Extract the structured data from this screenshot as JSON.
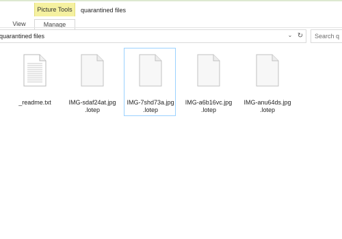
{
  "ribbon": {
    "context_group": "Picture Tools",
    "tabs": [
      "View",
      "Manage"
    ],
    "window_title": "quarantined files"
  },
  "address": {
    "path": "quarantined files",
    "search_placeholder": "Search q"
  },
  "files": [
    {
      "line1": "_readme.txt",
      "line2": "",
      "type": "text",
      "selected": false
    },
    {
      "line1": "IMG-sdaf24at.jpg",
      "line2": ".lotep",
      "type": "blank",
      "selected": false
    },
    {
      "line1": "IMG-7shd73a.jpg",
      "line2": ".lotep",
      "type": "blank",
      "selected": true
    },
    {
      "line1": "IMG-a6b16vc.jpg",
      "line2": ".lotep",
      "type": "blank",
      "selected": false
    },
    {
      "line1": "IMG-anu64ds.jpg",
      "line2": ".lotep",
      "type": "blank",
      "selected": false
    }
  ],
  "colors": {
    "context_highlight": "#f5f1a0",
    "selection_border": "#99d1ff"
  }
}
